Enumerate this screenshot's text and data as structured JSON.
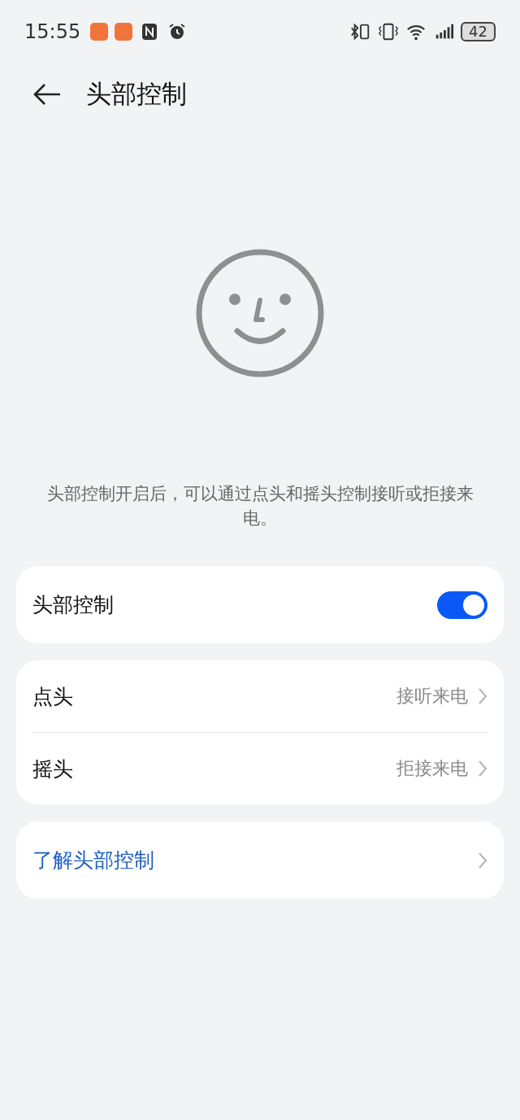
{
  "status_bar": {
    "time": "15:55",
    "battery": "42"
  },
  "header": {
    "title": "头部控制"
  },
  "description": "头部控制开启后，可以通过点头和摇头控制接听或拒接来电。",
  "main_toggle": {
    "label": "头部控制",
    "on": true
  },
  "gestures": [
    {
      "label": "点头",
      "value": "接听来电"
    },
    {
      "label": "摇头",
      "value": "拒接来电"
    }
  ],
  "learn_more": {
    "label": "了解头部控制"
  }
}
